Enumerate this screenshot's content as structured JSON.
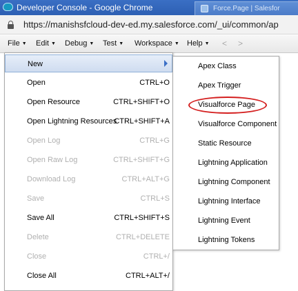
{
  "browser": {
    "window_title": "Developer Console - Google Chrome",
    "other_tab_title": "Force.Page | Salesfor",
    "url": "https://manishsfcloud-dev-ed.my.salesforce.com/_ui/common/ap"
  },
  "menubar": {
    "items": [
      "File",
      "Edit",
      "Debug",
      "Test",
      "Workspace",
      "Help"
    ],
    "back_arrow": "<",
    "forward_arrow": ">"
  },
  "file_menu": {
    "items": [
      {
        "label": "New",
        "shortcut": ""
      },
      {
        "label": "Open",
        "shortcut": "CTRL+O"
      },
      {
        "label": "Open Resource",
        "shortcut": "CTRL+SHIFT+O"
      },
      {
        "label": "Open Lightning Resources",
        "shortcut": "CTRL+SHIFT+A"
      },
      {
        "label": "Open Log",
        "shortcut": "CTRL+G"
      },
      {
        "label": "Open Raw Log",
        "shortcut": "CTRL+SHIFT+G"
      },
      {
        "label": "Download Log",
        "shortcut": "CTRL+ALT+G"
      },
      {
        "label": "Save",
        "shortcut": "CTRL+S"
      },
      {
        "label": "Save All",
        "shortcut": "CTRL+SHIFT+S"
      },
      {
        "label": "Delete",
        "shortcut": "CTRL+DELETE"
      },
      {
        "label": "Close",
        "shortcut": "CTRL+/"
      },
      {
        "label": "Close All",
        "shortcut": "CTRL+ALT+/"
      }
    ]
  },
  "new_submenu": {
    "items": [
      "Apex Class",
      "Apex Trigger",
      "Visualforce Page",
      "Visualforce Component",
      "Static Resource",
      "Lightning Application",
      "Lightning Component",
      "Lightning Interface",
      "Lightning Event",
      "Lightning Tokens"
    ]
  },
  "colors": {
    "highlight_oval": "#d41f1f",
    "titlebar": "#2d5fb3",
    "submenu_arrow": "#3b6fc6"
  }
}
